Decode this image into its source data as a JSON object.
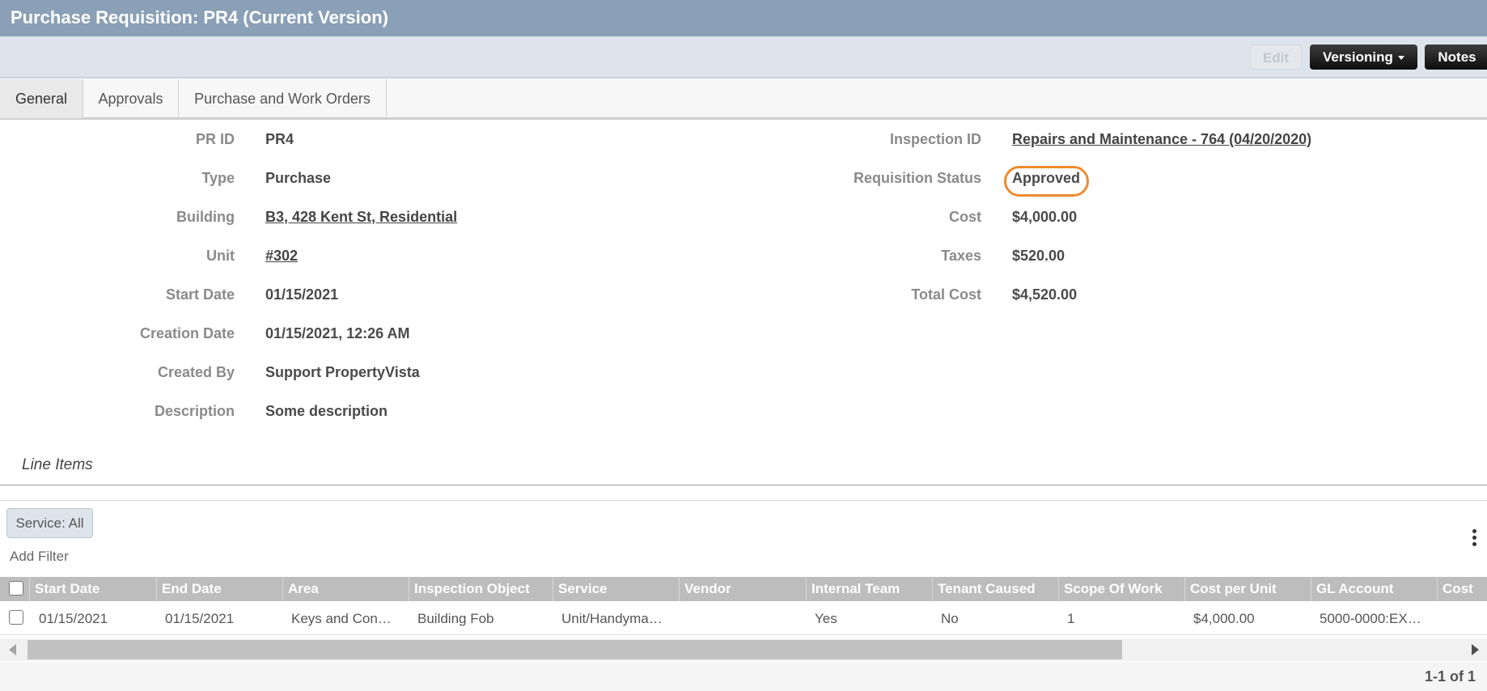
{
  "window": {
    "title": "Purchase Requisition: PR4 (Current Version)"
  },
  "toolbar": {
    "edit_label": "Edit",
    "versioning_label": "Versioning",
    "notes_label": "Notes"
  },
  "tabs": [
    {
      "label": "General",
      "active": true
    },
    {
      "label": "Approvals",
      "active": false
    },
    {
      "label": "Purchase and Work Orders",
      "active": false
    }
  ],
  "general": {
    "pr_id": {
      "label": "PR ID",
      "value": "PR4"
    },
    "type": {
      "label": "Type",
      "value": "Purchase"
    },
    "building": {
      "label": "Building",
      "value": "B3, 428 Kent St, Residential"
    },
    "unit": {
      "label": "Unit",
      "value": "#302"
    },
    "start_date": {
      "label": "Start Date",
      "value": "01/15/2021"
    },
    "creation_date": {
      "label": "Creation Date",
      "value": "01/15/2021, 12:26 AM"
    },
    "created_by": {
      "label": "Created By",
      "value": "Support PropertyVista"
    },
    "description": {
      "label": "Description",
      "value": "Some description"
    },
    "inspection_id": {
      "label": "Inspection ID",
      "value": "Repairs and Maintenance - 764 (04/20/2020)"
    },
    "requisition_status": {
      "label": "Requisition Status",
      "value": "Approved",
      "highlight_color": "#f08a2d"
    },
    "cost": {
      "label": "Cost",
      "value": "$4,000.00"
    },
    "taxes": {
      "label": "Taxes",
      "value": "$520.00"
    },
    "total_cost": {
      "label": "Total Cost",
      "value": "$4,520.00"
    }
  },
  "line_items": {
    "section_title": "Line Items",
    "filter_chip": "Service: All",
    "add_filter": "Add Filter",
    "columns": [
      "Start Date",
      "End Date",
      "Area",
      "Inspection Object",
      "Service",
      "Vendor",
      "Internal Team",
      "Tenant Caused",
      "Scope Of Work",
      "Cost per Unit",
      "GL Account",
      "Cost"
    ],
    "rows": [
      [
        "01/15/2021",
        "01/15/2021",
        "Keys and Con…",
        "Building Fob",
        "Unit/Handyma…",
        "",
        "Yes",
        "No",
        "1",
        "$4,000.00",
        "5000-0000:EX…",
        ""
      ]
    ],
    "pager": "1-1 of 1",
    "more_icon": "kebab-vertical-icon"
  },
  "colors": {
    "title_bar": "#8aa0b6",
    "toolbar": "#dde4ec",
    "grid_header": "#bdbdbd",
    "status_ring": "#f08a2d"
  }
}
